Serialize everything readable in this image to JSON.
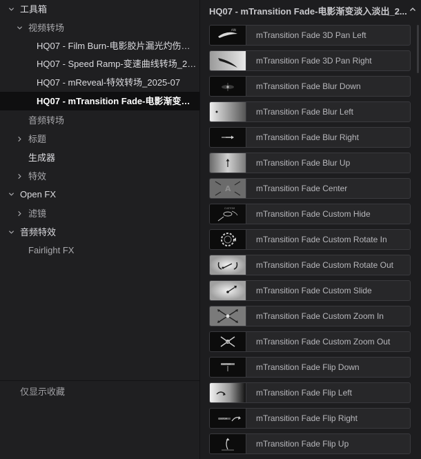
{
  "tree": {
    "items": [
      {
        "label": "工具箱",
        "expanded": true
      },
      {
        "label": "视频转场",
        "expanded": true
      },
      {
        "label": "HQ07 - Film Burn-电影胶片漏光灼伤转..."
      },
      {
        "label": "HQ07 - Speed Ramp-变速曲线转场_20..."
      },
      {
        "label": "HQ07 - mReveal-特效转场_2025-07"
      },
      {
        "label": "HQ07 - mTransition Fade-电影渐变淡...",
        "selected": true
      },
      {
        "label": "音频转场"
      },
      {
        "label": "标题",
        "expanded": false
      },
      {
        "label": "生成器"
      },
      {
        "label": "特效",
        "expanded": false
      },
      {
        "label": "Open FX",
        "expanded": true
      },
      {
        "label": "滤镜",
        "expanded": false
      },
      {
        "label": "音频特效",
        "expanded": true
      },
      {
        "label": "Fairlight FX"
      }
    ],
    "favorites_label": "仅显示收藏"
  },
  "panel": {
    "title": "HQ07 - mTransition Fade-电影渐变淡入淡出_2...",
    "collapse_icon": "chevron-up-icon",
    "items": [
      {
        "label": "mTransition Fade 3D Pan Left",
        "thumb": "pan-left"
      },
      {
        "label": "mTransition Fade 3D Pan Right",
        "thumb": "pan-right"
      },
      {
        "label": "mTransition Fade Blur Down",
        "thumb": "blur-down"
      },
      {
        "label": "mTransition Fade Blur Left",
        "thumb": "blur-left"
      },
      {
        "label": "mTransition Fade Blur Right",
        "thumb": "blur-right"
      },
      {
        "label": "mTransition Fade Blur Up",
        "thumb": "blur-up"
      },
      {
        "label": "mTransition Fade Center",
        "thumb": "center"
      },
      {
        "label": "mTransition Fade Custom Hide",
        "thumb": "custom-hide"
      },
      {
        "label": "mTransition Fade Custom Rotate In",
        "thumb": "rotate-in"
      },
      {
        "label": "mTransition Fade Custom Rotate Out",
        "thumb": "rotate-out"
      },
      {
        "label": "mTransition Fade Custom Slide",
        "thumb": "custom-slide"
      },
      {
        "label": "mTransition Fade Custom Zoom In",
        "thumb": "zoom-in"
      },
      {
        "label": "mTransition Fade Custom Zoom Out",
        "thumb": "zoom-out"
      },
      {
        "label": "mTransition Fade Flip Down",
        "thumb": "flip-down"
      },
      {
        "label": "mTransition Fade Flip Left",
        "thumb": "flip-left"
      },
      {
        "label": "mTransition Fade Flip Right",
        "thumb": "flip-right"
      },
      {
        "label": "mTransition Fade Flip Up",
        "thumb": "flip-up"
      }
    ]
  }
}
